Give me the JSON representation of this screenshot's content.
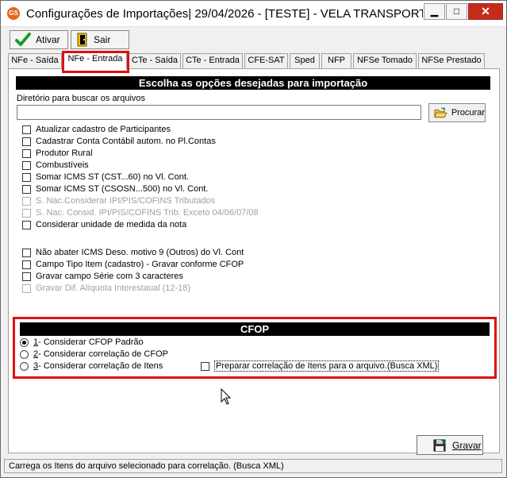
{
  "window": {
    "title": "Configurações de Importações|  29/04/2026 - [TESTE] - VELA TRANSPORT...",
    "app_icon_text": "GS",
    "min_glyph": "▁",
    "max_glyph": "□",
    "close_glyph": "✕"
  },
  "toolbar": {
    "ativar_label": "Ativar",
    "sair_label": "Sair"
  },
  "tabs": [
    {
      "label": "NFe - Saída"
    },
    {
      "label": "NFe - Entrada"
    },
    {
      "label": "CTe - Saída"
    },
    {
      "label": "CTe - Entrada"
    },
    {
      "label": "CFE-SAT"
    },
    {
      "label": "Sped"
    },
    {
      "label": "NFP"
    },
    {
      "label": "NFSe Tomado"
    },
    {
      "label": "NFSe Prestado"
    }
  ],
  "panel": {
    "header": "Escolha as opções desejadas para importação",
    "dir_label": "Diretório para buscar os arquivos",
    "dir_value": "",
    "procurar_label": "Procurar",
    "options": [
      {
        "label": "Atualizar cadastro de Participantes"
      },
      {
        "label": "Cadastrar Conta Contábil autom. no Pl.Contas"
      },
      {
        "label": "Produtor Rural"
      },
      {
        "label": "Combustíveis"
      },
      {
        "label": "Somar ICMS ST (CST...60) no Vl. Cont."
      },
      {
        "label": "Somar ICMS ST (CSOSN...500) no Vl. Cont."
      },
      {
        "label": "S. Nac.Considerar IPI/PIS/COFINS Tributados"
      },
      {
        "label": "S. Nac. Consid. IPI/PIS/COFINS Trib. Exceto 04/06/07/08"
      },
      {
        "label": "Considerar unidade de medida da nota"
      }
    ],
    "options2": [
      {
        "label": "Não abater ICMS Deso. motivo 9 (Outros) do Vl. Cont"
      },
      {
        "label": "Campo Tipo Item (cadastro) - Gravar conforme CFOP"
      },
      {
        "label": "Gravar campo Série com 3 caracteres"
      },
      {
        "label": "Gravar Dif. Alíquota Interestaual (12-18)"
      }
    ]
  },
  "cfop": {
    "header": "CFOP",
    "options": [
      {
        "num": "1",
        "label": " - Considerar CFOP Padrão"
      },
      {
        "num": "2",
        "label": " - Considerar correlação de CFOP"
      },
      {
        "num": "3",
        "label": " - Considerar correlação de Itens"
      }
    ],
    "busca_label": "Preparar correlação de Itens para o arquivo.(Busca XML)"
  },
  "gravar_label": "Gravar",
  "status_text": "Carrega os Itens do arquivo selecionado para correlação. (Busca XML)",
  "colors": {
    "highlight": "#e01010",
    "header_bg": "#000000",
    "close_bg": "#c42b1c"
  }
}
